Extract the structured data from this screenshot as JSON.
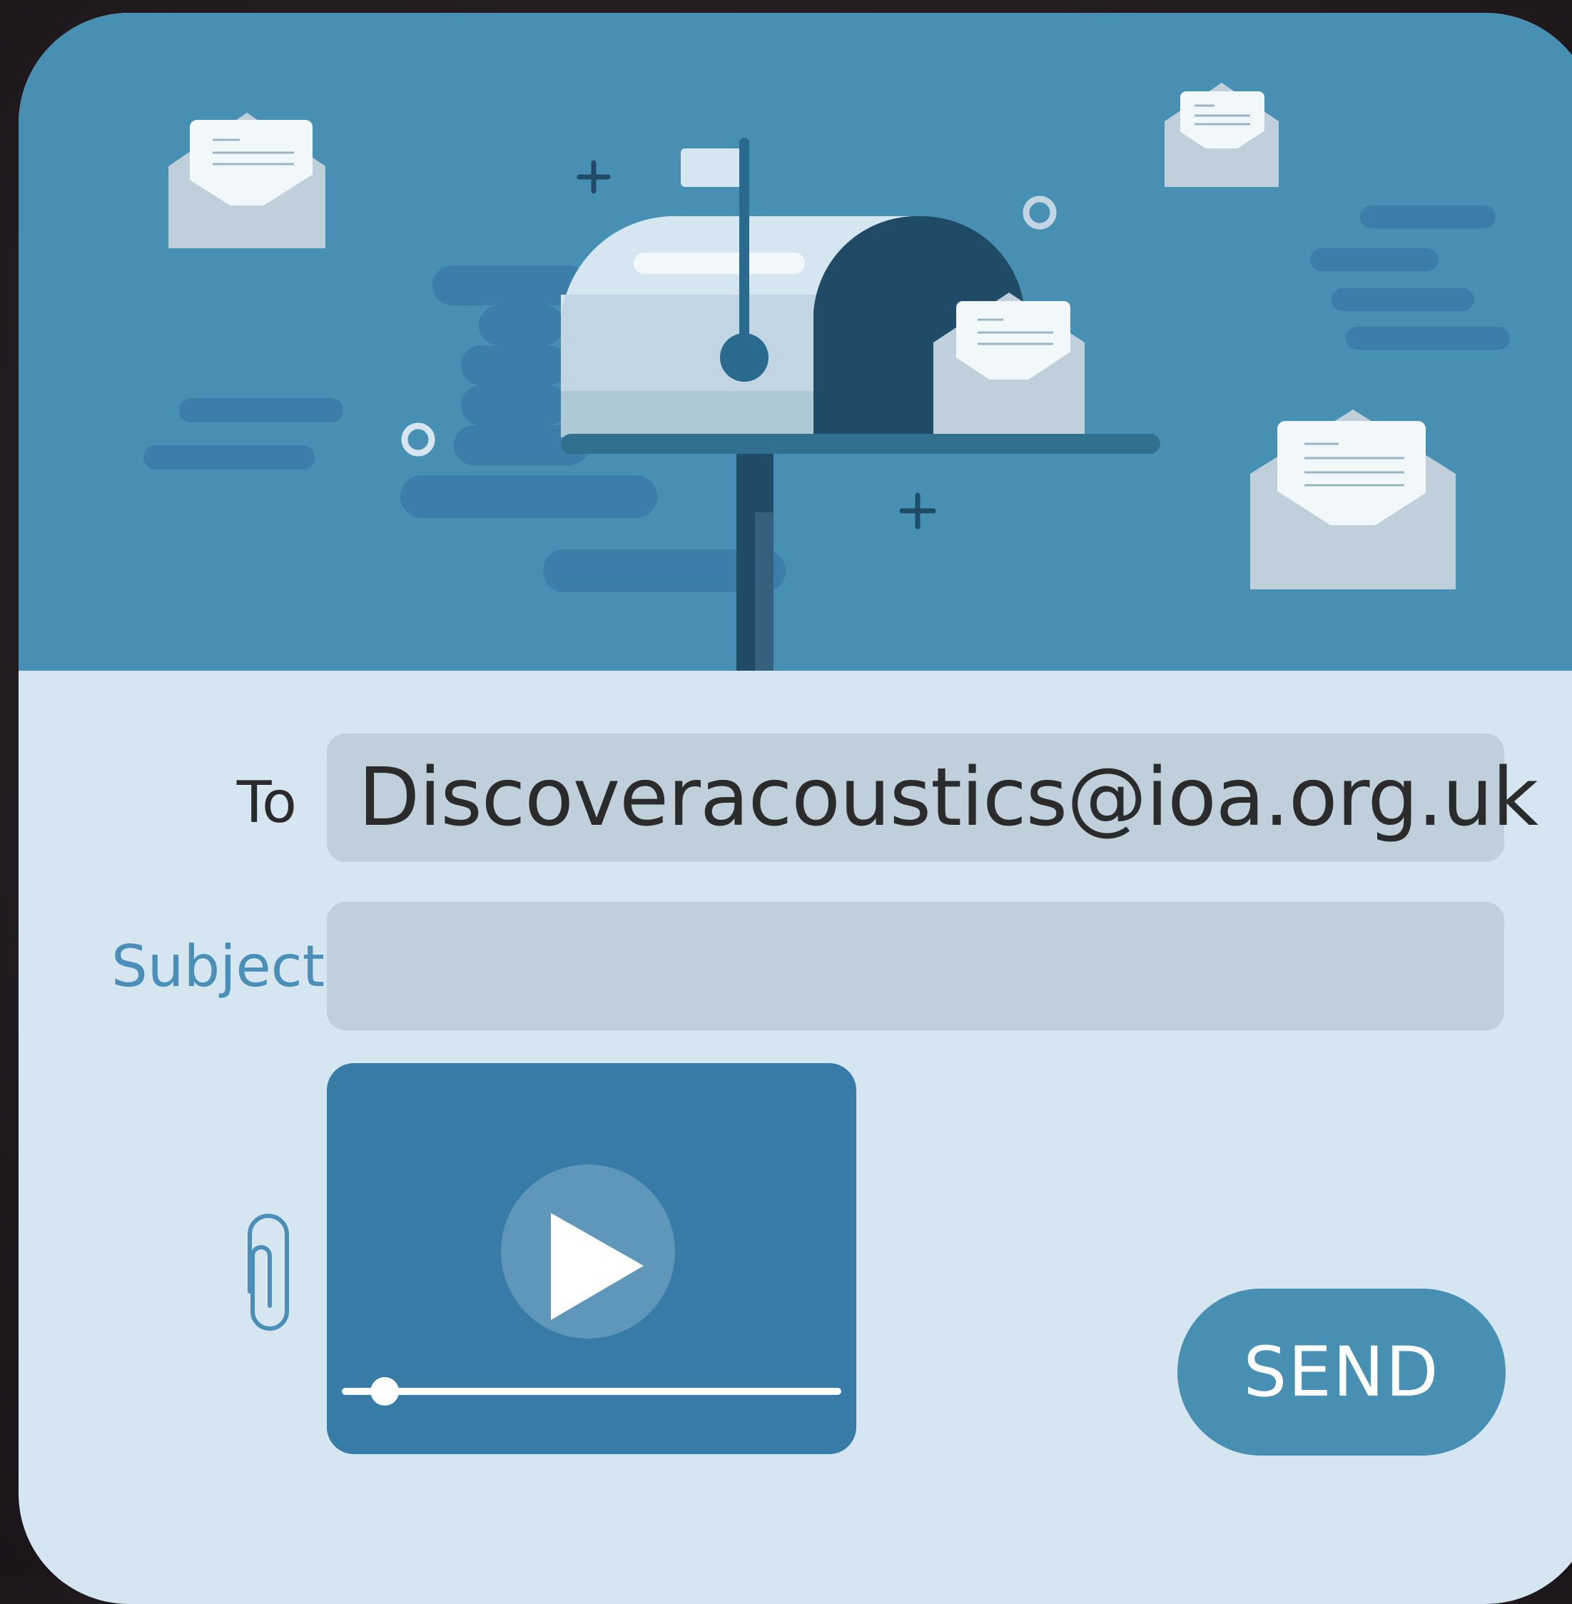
{
  "compose": {
    "to_label": "To",
    "to_value": "Discoveracoustics@ioa.org.uk",
    "subject_label": "Subject",
    "subject_value": "",
    "send_label": "SEND"
  },
  "attachment": {
    "type": "video",
    "progress": 0.08
  },
  "icons": {
    "attach": "paperclip-icon",
    "play": "play-icon",
    "illustration": "mailbox-illustration"
  },
  "colors": {
    "hero_bg": "#4790b4",
    "form_bg": "#d6e6f0",
    "field_bg": "#bfd0da",
    "accent": "#4790b4",
    "video_bg": "#377ca6",
    "subject_label": "#4a8fb8"
  }
}
